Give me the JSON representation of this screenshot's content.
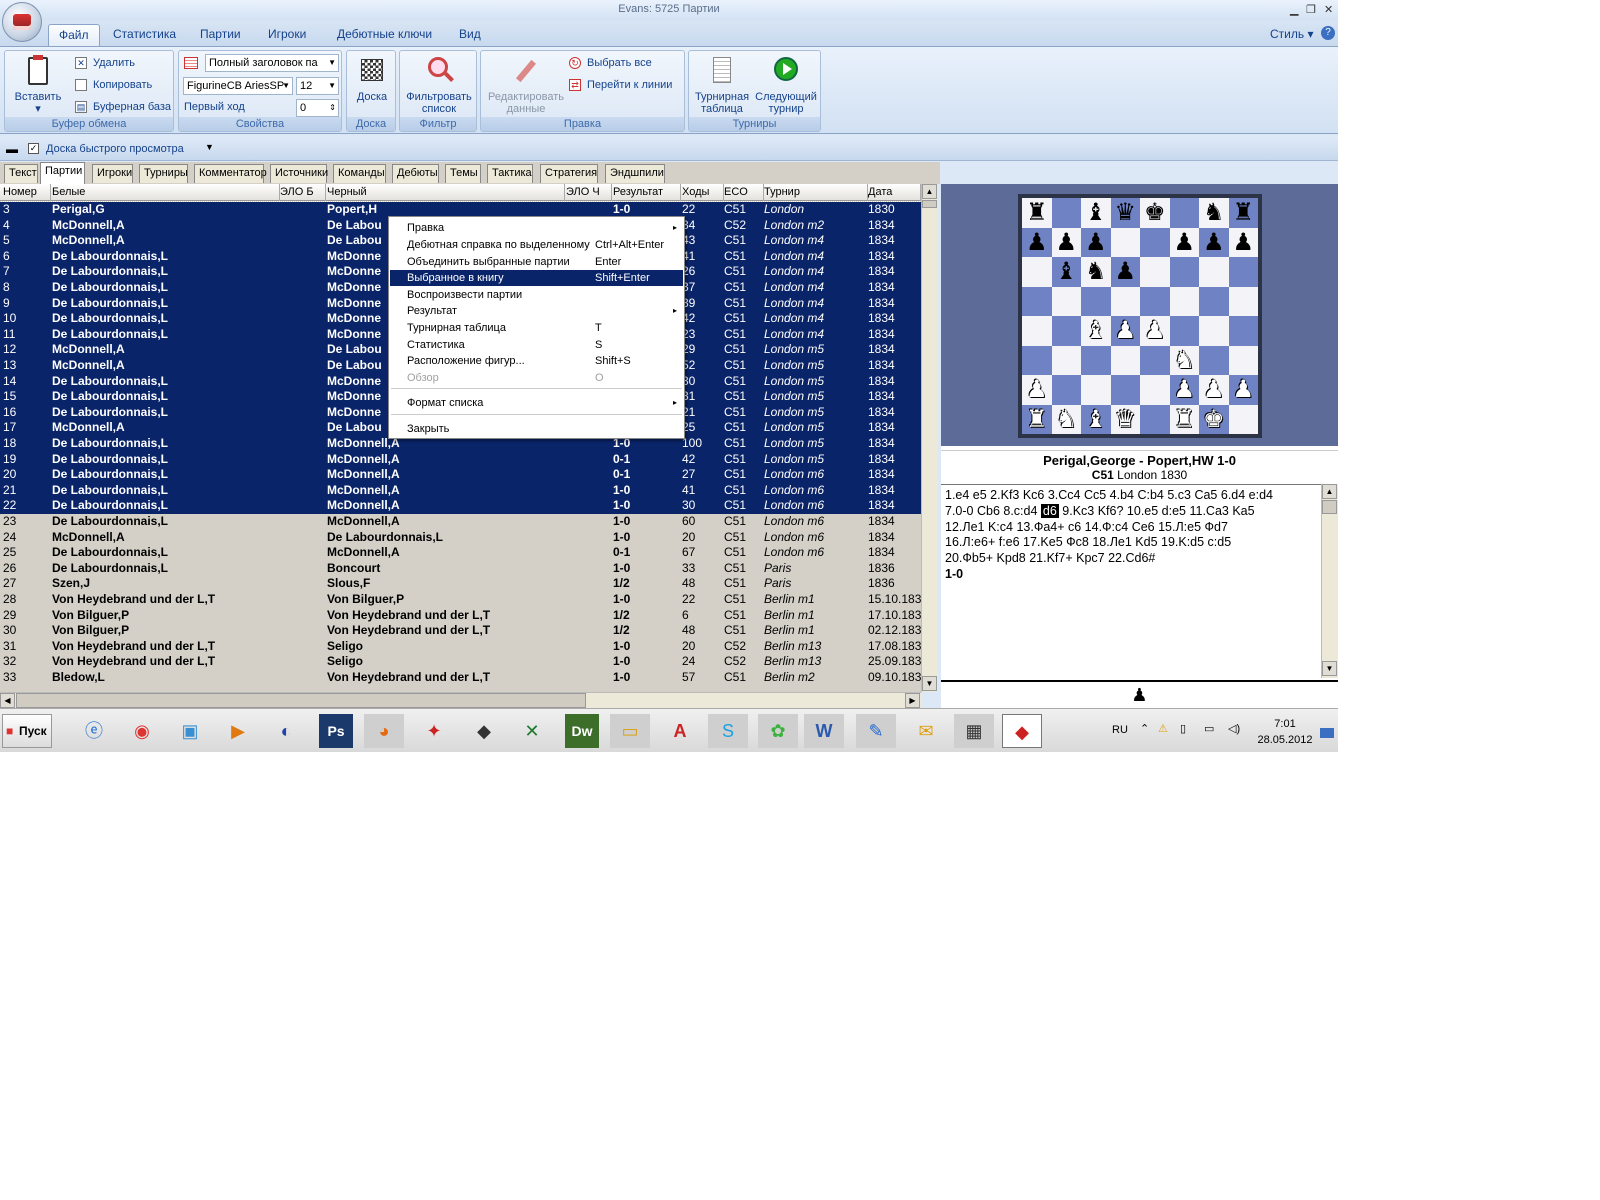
{
  "window": {
    "title": "Evans:  5725 Партии",
    "style_label": "Стиль"
  },
  "ribbon_tabs": [
    "Файл",
    "Статистика",
    "Партии",
    "Игроки",
    "Дебютные ключи",
    "Вид"
  ],
  "clipboard": {
    "paste": "Вставить",
    "delete": "Удалить",
    "copy": "Копировать",
    "buffer_db": "Буферная база",
    "title": "Буфер обмена"
  },
  "properties": {
    "header_combo": "Полный заголовок па",
    "font_combo": "FigurineCB AriesSP",
    "size_combo": "12",
    "first_move_label": "Первый ход",
    "first_move_value": "0",
    "title": "Свойства"
  },
  "board_group": {
    "button": "Доска",
    "title": "Доска"
  },
  "filter_group": {
    "button_line1": "Фильтровать",
    "button_line2": "список",
    "title": "Фильтр"
  },
  "edit_group": {
    "edit_line1": "Редактировать",
    "edit_line2": "данные",
    "select_all": "Выбрать все",
    "goto_line": "Перейти к линии",
    "title": "Правка"
  },
  "tourn_group": {
    "table_line1": "Турнирная",
    "table_line2": "таблица",
    "next_line1": "Следующий",
    "next_line2": "турнир",
    "title": "Турниры"
  },
  "quickbar": {
    "preview_label": "Доска быстрого просмотра"
  },
  "list_tabs": [
    "Текст",
    "Партии",
    "Игроки",
    "Турниры",
    "Комментатор",
    "Источники",
    "Команды",
    "Дебюты",
    "Темы",
    "Тактика",
    "Стратегия",
    "Эндшпили"
  ],
  "columns": [
    "Номер",
    "Белые",
    "ЭЛО Б",
    "Черный",
    "ЭЛО Ч",
    "Результат",
    "Ходы",
    "ECO",
    "Турнир",
    "Дата"
  ],
  "rows": [
    [
      "3",
      "Perigal,G",
      "",
      "Popert,H",
      "",
      "1-0",
      "22",
      "C51",
      "London",
      "1830"
    ],
    [
      "4",
      "McDonnell,A",
      "",
      "De Labou",
      "",
      "",
      "34",
      "C52",
      "London m2",
      "1834"
    ],
    [
      "5",
      "McDonnell,A",
      "",
      "De Labou",
      "",
      "",
      "43",
      "C51",
      "London m4",
      "1834"
    ],
    [
      "6",
      "De Labourdonnais,L",
      "",
      "McDonne",
      "",
      "",
      "41",
      "C51",
      "London m4",
      "1834"
    ],
    [
      "7",
      "De Labourdonnais,L",
      "",
      "McDonne",
      "",
      "",
      "26",
      "C51",
      "London m4",
      "1834"
    ],
    [
      "8",
      "De Labourdonnais,L",
      "",
      "McDonne",
      "",
      "",
      "37",
      "C51",
      "London m4",
      "1834"
    ],
    [
      "9",
      "De Labourdonnais,L",
      "",
      "McDonne",
      "",
      "",
      "39",
      "C51",
      "London m4",
      "1834"
    ],
    [
      "10",
      "De Labourdonnais,L",
      "",
      "McDonne",
      "",
      "",
      "42",
      "C51",
      "London m4",
      "1834"
    ],
    [
      "11",
      "De Labourdonnais,L",
      "",
      "McDonne",
      "",
      "",
      "23",
      "C51",
      "London m4",
      "1834"
    ],
    [
      "12",
      "McDonnell,A",
      "",
      "De Labou",
      "",
      "",
      "29",
      "C51",
      "London m5",
      "1834"
    ],
    [
      "13",
      "McDonnell,A",
      "",
      "De Labou",
      "",
      "",
      "52",
      "C51",
      "London m5",
      "1834"
    ],
    [
      "14",
      "De Labourdonnais,L",
      "",
      "McDonne",
      "",
      "",
      "30",
      "C51",
      "London m5",
      "1834"
    ],
    [
      "15",
      "De Labourdonnais,L",
      "",
      "McDonne",
      "",
      "",
      "31",
      "C51",
      "London m5",
      "1834"
    ],
    [
      "16",
      "De Labourdonnais,L",
      "",
      "McDonne",
      "",
      "",
      "21",
      "C51",
      "London m5",
      "1834"
    ],
    [
      "17",
      "McDonnell,A",
      "",
      "De Labou",
      "",
      "",
      "25",
      "C51",
      "London m5",
      "1834"
    ],
    [
      "18",
      "De Labourdonnais,L",
      "",
      "McDonnell,A",
      "",
      "1-0",
      "100",
      "C51",
      "London m5",
      "1834"
    ],
    [
      "19",
      "De Labourdonnais,L",
      "",
      "McDonnell,A",
      "",
      "0-1",
      "42",
      "C51",
      "London m5",
      "1834"
    ],
    [
      "20",
      "De Labourdonnais,L",
      "",
      "McDonnell,A",
      "",
      "0-1",
      "27",
      "C51",
      "London m6",
      "1834"
    ],
    [
      "21",
      "De Labourdonnais,L",
      "",
      "McDonnell,A",
      "",
      "1-0",
      "41",
      "C51",
      "London m6",
      "1834"
    ],
    [
      "22",
      "De Labourdonnais,L",
      "",
      "McDonnell,A",
      "",
      "1-0",
      "30",
      "C51",
      "London m6",
      "1834"
    ],
    [
      "23",
      "De Labourdonnais,L",
      "",
      "McDonnell,A",
      "",
      "1-0",
      "60",
      "C51",
      "London m6",
      "1834"
    ],
    [
      "24",
      "McDonnell,A",
      "",
      "De Labourdonnais,L",
      "",
      "1-0",
      "20",
      "C51",
      "London m6",
      "1834"
    ],
    [
      "25",
      "De Labourdonnais,L",
      "",
      "McDonnell,A",
      "",
      "0-1",
      "67",
      "C51",
      "London m6",
      "1834"
    ],
    [
      "26",
      "De Labourdonnais,L",
      "",
      "Boncourt",
      "",
      "1-0",
      "33",
      "C51",
      "Paris",
      "1836"
    ],
    [
      "27",
      "Szen,J",
      "",
      "Slous,F",
      "",
      "1/2",
      "48",
      "C51",
      "Paris",
      "1836"
    ],
    [
      "28",
      "Von Heydebrand und der L,T",
      "",
      "Von Bilguer,P",
      "",
      "1-0",
      "22",
      "C51",
      "Berlin m1",
      "15.10.183"
    ],
    [
      "29",
      "Von Bilguer,P",
      "",
      "Von Heydebrand und der L,T",
      "",
      "1/2",
      "6",
      "C51",
      "Berlin m1",
      "17.10.183"
    ],
    [
      "30",
      "Von Bilguer,P",
      "",
      "Von Heydebrand und der L,T",
      "",
      "1/2",
      "48",
      "C51",
      "Berlin m1",
      "02.12.183"
    ],
    [
      "31",
      "Von Heydebrand und der L,T",
      "",
      "Seligo",
      "",
      "1-0",
      "20",
      "C52",
      "Berlin m13",
      "17.08.183"
    ],
    [
      "32",
      "Von Heydebrand und der L,T",
      "",
      "Seligo",
      "",
      "1-0",
      "24",
      "C52",
      "Berlin m13",
      "25.09.183"
    ],
    [
      "33",
      "Bledow,L",
      "",
      "Von Heydebrand und der L,T",
      "",
      "1-0",
      "57",
      "C51",
      "Berlin m2",
      "09.10.183"
    ]
  ],
  "menu": {
    "items": [
      {
        "label": "Правка",
        "shortcut": "",
        "arrow": "▸"
      },
      {
        "label": "Дебютная справка по выделенному",
        "shortcut": "Ctrl+Alt+Enter",
        "arrow": ""
      },
      {
        "label": "Объединить выбранные партии",
        "shortcut": "Enter",
        "arrow": ""
      },
      {
        "label": "Выбранное в книгу",
        "shortcut": "Shift+Enter",
        "arrow": ""
      },
      {
        "label": "Воспроизвести партии",
        "shortcut": "",
        "arrow": ""
      },
      {
        "label": "Результат",
        "shortcut": "",
        "arrow": "▸"
      },
      {
        "label": "Турнирная таблица",
        "shortcut": "T",
        "arrow": ""
      },
      {
        "label": "Статистика",
        "shortcut": "S",
        "arrow": ""
      },
      {
        "label": "Расположение фигур...",
        "shortcut": "Shift+S",
        "arrow": ""
      },
      {
        "label": "Обзор",
        "shortcut": "O",
        "arrow": ""
      },
      {
        "label": "Формат списка",
        "shortcut": "",
        "arrow": "▸"
      },
      {
        "label": "Закрыть",
        "shortcut": "",
        "arrow": ""
      }
    ]
  },
  "game": {
    "title": "Perigal,George - Popert,HW  1-0",
    "eco": "C51",
    "event": "London 1830",
    "notation_parts": [
      "1.e4 e5 2.Kf3 Kc6 3.Cc4 Cc5 4.b4 C:b4 5.c3 Ca5 6.d4 e:d4",
      "7.0-0 Cb6 8.c:d4 ",
      "d6",
      " 9.Kc3 Kf6? 10.e5 d:e5 11.Ca3 Ka5",
      "12.Ле1 K:c4 13.Фа4+ c6 14.Ф:c4 Ce6 15.Л:e5 Фd7",
      "16.Л:e6+ f:e6 17.Ke5 Фc8 18.Ле1 Kd5 19.K:d5 c:d5",
      "20.Фb5+ Kpd8 21.Kf7+ Kpc7 22.Cd6#"
    ],
    "result": "1-0",
    "to_move": "♟"
  },
  "board": [
    "r.bqk.nr",
    "ppp..ppp",
    ".bnp....",
    "........",
    "..BPP...",
    ".....N..",
    "P....PPP",
    "RNBQ.RK."
  ],
  "taskbar": {
    "start": "Пуск",
    "lang": "RU",
    "time": "7:01",
    "date": "28.05.2012"
  }
}
